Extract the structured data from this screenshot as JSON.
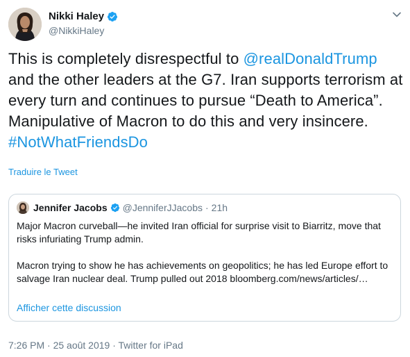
{
  "author": {
    "name": "Nikki Haley",
    "handle": "@NikkiHaley"
  },
  "tweet": {
    "t1": "This is completely disrespectful to ",
    "mention": "@realDonaldTrump",
    "t2": " and the other leaders at the G7. Iran supports terrorism at every turn and continues to pursue “Death to America”. Manipulative of Macron to do this and very insincere. ",
    "hashtag": "#NotWhatFriendsDo"
  },
  "translate_label": "Traduire le Tweet",
  "quoted": {
    "name": "Jennifer Jacobs",
    "handle": "@JenniferJJacobs",
    "separator": "·",
    "time": "21h",
    "paragraph1": "Major Macron curveball—he invited Iran official for surprise visit to Biarritz, move that risks infuriating Trump admin.",
    "paragraph2": "Macron trying to show he has achievements on geopolitics; he has led Europe effort to salvage Iran nuclear deal. Trump pulled out 2018 bloomberg.com/news/articles/…",
    "show_thread": "Afficher cette discussion"
  },
  "meta": {
    "timestamp": "7:26 PM · 25 août 2019 · ",
    "source": "Twitter for iPad"
  },
  "colors": {
    "link": "#1b95e0",
    "verified": "#1da1f2",
    "secondary": "#657786",
    "border": "#ccd6dd"
  },
  "icons": {
    "verified": "verified-badge-icon",
    "menu": "chevron-down-icon"
  }
}
